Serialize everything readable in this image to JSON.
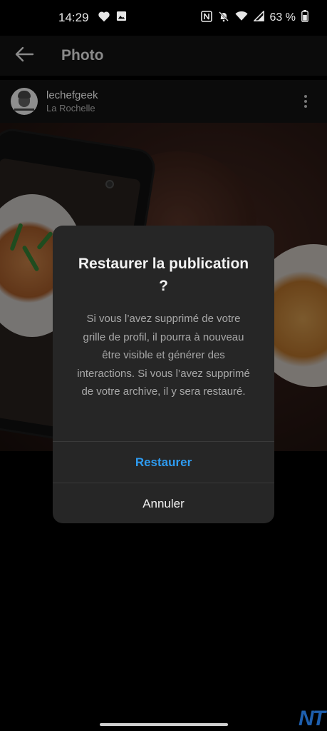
{
  "status_bar": {
    "time": "14:29",
    "battery_percent": "63 %",
    "left_icons": [
      "heart-icon",
      "image-icon"
    ],
    "right_icons": [
      "nfc-icon",
      "mute-icon",
      "wifi-icon",
      "signal-icon",
      "battery-icon"
    ]
  },
  "header": {
    "title": "Photo",
    "back_icon": "arrow-left-icon"
  },
  "post": {
    "username": "lechefgeek",
    "location": "La Rochelle",
    "more_icon": "more-vertical-icon"
  },
  "dialog": {
    "title": "Restaurer la publication ?",
    "message": "Si vous l’avez supprimé de votre grille de profil, il pourra à nouveau être visible et générer des interactions. Si vous l’avez supprimé de votre archive, il y sera restauré.",
    "primary_label": "Restaurer",
    "secondary_label": "Annuler"
  },
  "watermark": "NT",
  "colors": {
    "accent": "#2e9bf0",
    "dialog_bg": "#262626",
    "background": "#000000"
  }
}
